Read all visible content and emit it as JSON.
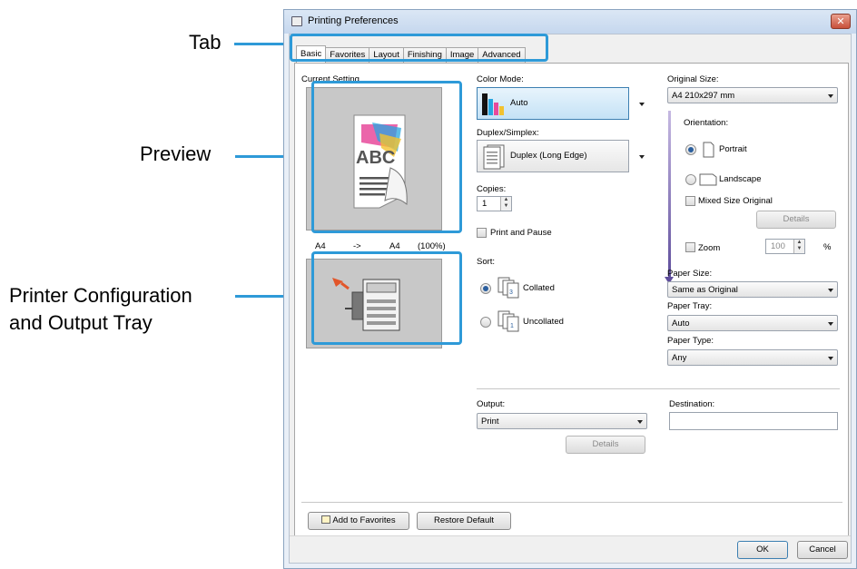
{
  "callouts": {
    "tab": "Tab",
    "preview": "Preview",
    "printer_config": [
      "Printer Configuration",
      "and Output Tray"
    ]
  },
  "colors": {
    "callout": "#2e9ad8",
    "window_bg": "#e9eff7"
  },
  "window": {
    "title": "Printing Preferences",
    "close": "✕"
  },
  "tabs": [
    "Basic",
    "Favorites",
    "Layout",
    "Finishing",
    "Image",
    "Advanced"
  ],
  "left": {
    "current_setting_label": "Current Setting",
    "preview_text": "ABC",
    "size_from": "A4",
    "size_arrow": "->",
    "size_to": "A4",
    "size_pct": "(100%)"
  },
  "middle": {
    "color_mode_label": "Color Mode:",
    "color_mode_value": "Auto",
    "duplex_label": "Duplex/Simplex:",
    "duplex_value": "Duplex (Long Edge)",
    "copies_label": "Copies:",
    "copies_value": "1",
    "print_pause_label": "Print and Pause",
    "sort_label": "Sort:",
    "collated_label": "Collated",
    "uncollated_label": "Uncollated",
    "output_label": "Output:",
    "output_value": "Print",
    "details_label": "Details"
  },
  "right": {
    "original_size_label": "Original Size:",
    "original_size_value": "A4 210x297 mm",
    "orientation_label": "Orientation:",
    "portrait_label": "Portrait",
    "landscape_label": "Landscape",
    "mixed_label": "Mixed Size Original",
    "details_label": "Details",
    "zoom_label": "Zoom",
    "zoom_value": "100",
    "zoom_unit": "%",
    "paper_size_label": "Paper Size:",
    "paper_size_value": "Same as Original",
    "paper_tray_label": "Paper Tray:",
    "paper_tray_value": "Auto",
    "paper_type_label": "Paper Type:",
    "paper_type_value": "Any",
    "destination_label": "Destination:",
    "destination_value": ""
  },
  "footer": {
    "add_favorites": "Add to Favorites",
    "restore_default": "Restore Default",
    "ok": "OK",
    "cancel": "Cancel"
  }
}
